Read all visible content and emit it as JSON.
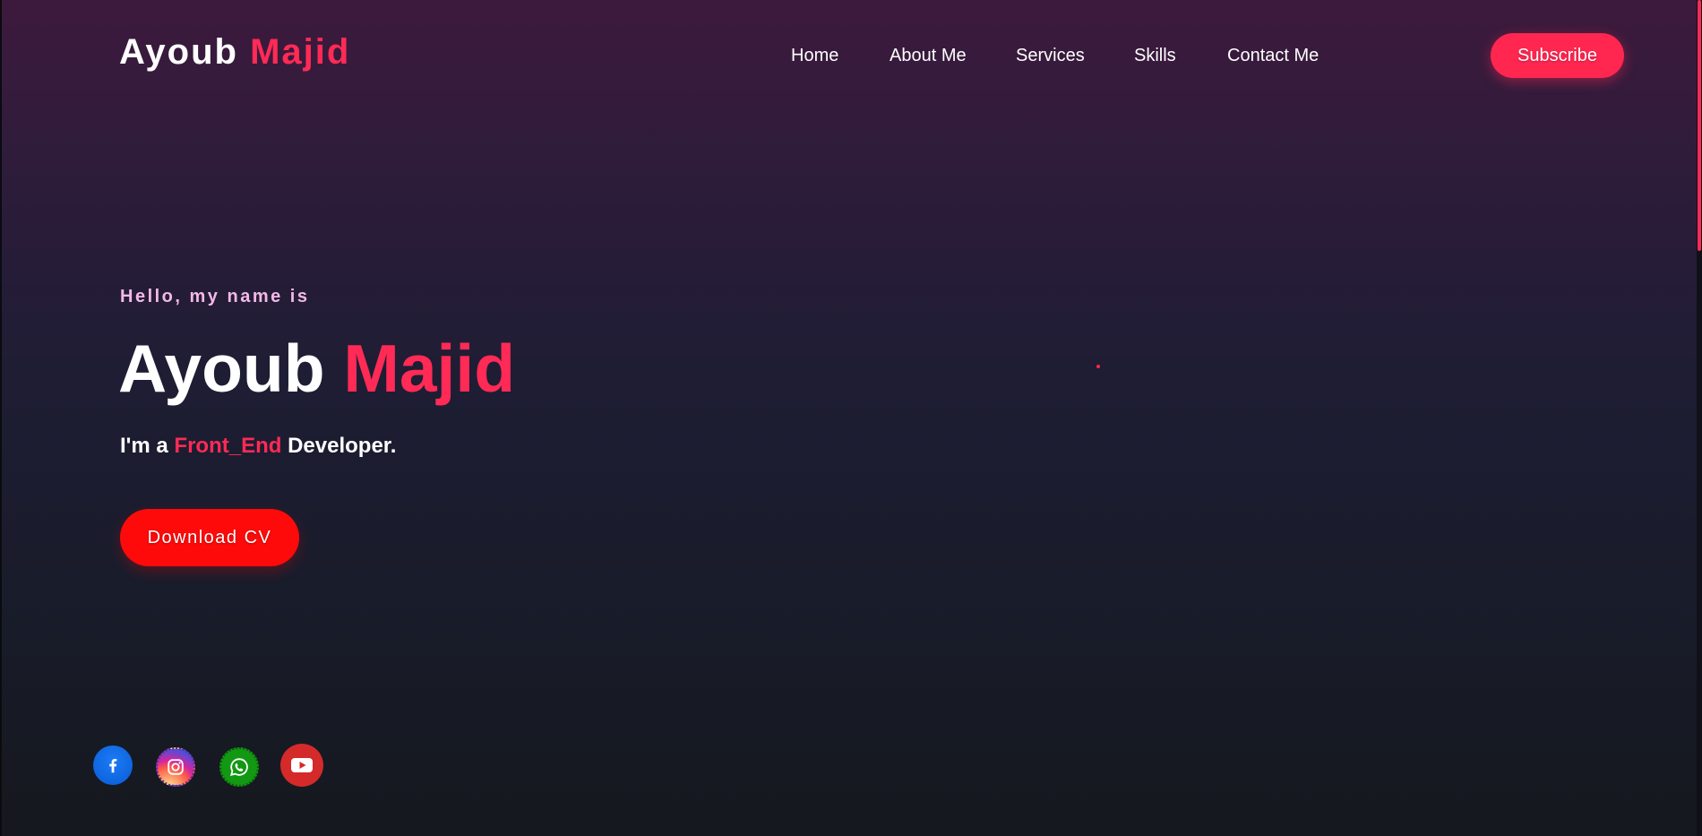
{
  "header": {
    "logo_first": "Ayoub",
    "logo_second": "Majid",
    "nav": {
      "home": "Home",
      "about": "About Me",
      "services": "Services",
      "skills": "Skills",
      "contact": "Contact Me"
    },
    "subscribe_label": "Subscribe"
  },
  "hero": {
    "greeting": "Hello, my name is",
    "name_first": "Ayoub",
    "name_second": "Majid",
    "role_prefix": "I'm a",
    "role_highlight": "Front_End",
    "role_suffix": "Developer.",
    "download_label": "Download CV"
  },
  "social": [
    "facebook-icon",
    "instagram-icon",
    "whatsapp-icon",
    "youtube-icon"
  ],
  "colors": {
    "accent": "#ff2a55",
    "download_button": "#ff0a0a",
    "greeting": "#f4b8e8",
    "background_top": "#3d1a3d",
    "background_bottom": "#15181e"
  }
}
